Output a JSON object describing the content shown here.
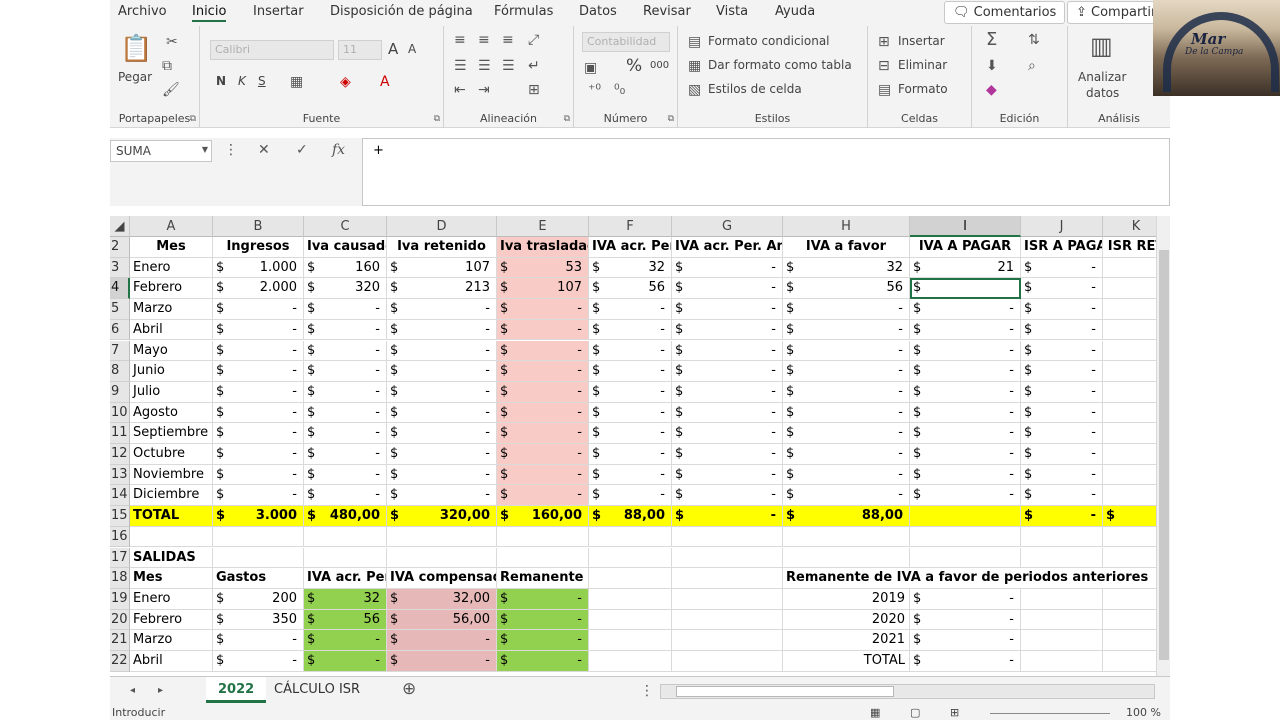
{
  "ribbon_tabs": [
    "Archivo",
    "Inicio",
    "Insertar",
    "Disposición de página",
    "Fórmulas",
    "Datos",
    "Revisar",
    "Vista",
    "Ayuda"
  ],
  "buttons": {
    "comentarios": "Comentarios",
    "compartir": "Compartir"
  },
  "groups": {
    "portapapeles": "Portapapeles",
    "fuente": "Fuente",
    "alineacion": "Alineación",
    "numero": "Número",
    "estilos": "Estilos",
    "celdas": "Celdas",
    "edicion": "Edición",
    "analisis": "Análisis"
  },
  "clip": {
    "pegar": "Pegar"
  },
  "font": {
    "name": "Calibri",
    "size": "11",
    "bold": "N",
    "italic": "K",
    "underline": "S",
    "grow": "A",
    "shrink": "A"
  },
  "numfmt": {
    "format": "Contabilidad",
    "percent": "%",
    "thousands": "000"
  },
  "styles": {
    "cond": "Formato condicional",
    "table": "Dar formato como tabla",
    "cell": "Estilos de celda"
  },
  "cells": {
    "insert": "Insertar",
    "delete": "Eliminar",
    "format": "Formato"
  },
  "analyze": {
    "l1": "Analizar",
    "l2": "datos"
  },
  "formula_bar": {
    "name_box": "SUMA",
    "formula": "+",
    "cancel": "✕",
    "enter": "✓",
    "fx": "fx"
  },
  "columns": [
    "A",
    "B",
    "C",
    "D",
    "E",
    "F",
    "G",
    "H",
    "I",
    "J",
    "K"
  ],
  "rows": [
    {
      "n": "2",
      "style": "header",
      "cells": [
        "Mes",
        "Ingresos",
        "Iva causado",
        "Iva retenido",
        "Iva trasladado",
        "IVA acr. Per.",
        "IVA acr. Per. Ant",
        "IVA a favor",
        "IVA A PAGAR",
        "ISR A PAGAR",
        "ISR RET"
      ]
    },
    {
      "n": "3",
      "cells": [
        "Enero",
        "1.000",
        "160",
        "107",
        "53",
        "32",
        "-",
        "32",
        "21",
        "-",
        ""
      ]
    },
    {
      "n": "4",
      "cells": [
        "Febrero",
        "2.000",
        "320",
        "213",
        "107",
        "56",
        "-",
        "56",
        "",
        "-",
        ""
      ]
    },
    {
      "n": "5",
      "cells": [
        "Marzo",
        "-",
        "-",
        "-",
        "-",
        "-",
        "-",
        "-",
        "-",
        "-",
        ""
      ]
    },
    {
      "n": "6",
      "cells": [
        "Abril",
        "-",
        "-",
        "-",
        "-",
        "-",
        "-",
        "-",
        "-",
        "-",
        ""
      ]
    },
    {
      "n": "7",
      "cells": [
        "Mayo",
        "-",
        "-",
        "-",
        "-",
        "-",
        "-",
        "-",
        "-",
        "-",
        ""
      ]
    },
    {
      "n": "8",
      "cells": [
        "Junio",
        "-",
        "-",
        "-",
        "-",
        "-",
        "-",
        "-",
        "-",
        "-",
        ""
      ]
    },
    {
      "n": "9",
      "cells": [
        "Julio",
        "-",
        "-",
        "-",
        "-",
        "-",
        "-",
        "-",
        "-",
        "-",
        ""
      ]
    },
    {
      "n": "10",
      "cells": [
        "Agosto",
        "-",
        "-",
        "-",
        "-",
        "-",
        "-",
        "-",
        "-",
        "-",
        ""
      ]
    },
    {
      "n": "11",
      "cells": [
        "Septiembre",
        "-",
        "-",
        "-",
        "-",
        "-",
        "-",
        "-",
        "-",
        "-",
        ""
      ]
    },
    {
      "n": "12",
      "cells": [
        "Octubre",
        "-",
        "-",
        "-",
        "-",
        "-",
        "-",
        "-",
        "-",
        "-",
        ""
      ]
    },
    {
      "n": "13",
      "cells": [
        "Noviembre",
        "-",
        "-",
        "-",
        "-",
        "-",
        "-",
        "-",
        "-",
        "-",
        ""
      ]
    },
    {
      "n": "14",
      "cells": [
        "Diciembre",
        "-",
        "-",
        "-",
        "-",
        "-",
        "-",
        "-",
        "-",
        "-",
        ""
      ]
    },
    {
      "n": "15",
      "style": "total",
      "cells": [
        "TOTAL",
        "3.000",
        "480,00",
        "320,00",
        "160,00",
        "88,00",
        "-",
        "88,00",
        "",
        "-",
        ""
      ]
    },
    {
      "n": "16",
      "cells": [
        "",
        "",
        "",
        "",
        "",
        "",
        "",
        "",
        "",
        "",
        ""
      ]
    },
    {
      "n": "17",
      "cells": [
        "SALIDAS",
        "",
        "",
        "",
        "",
        "",
        "",
        "",
        "",
        "",
        ""
      ]
    },
    {
      "n": "18",
      "style": "header2",
      "cells": [
        "Mes",
        "Gastos",
        "IVA acr. Per.",
        "IVA compensado",
        "Remanente de IVA",
        "",
        "",
        "Remanente de IVA a favor de periodos anteriores",
        "",
        "",
        ""
      ]
    },
    {
      "n": "19",
      "cells": [
        "Enero",
        "200",
        "32",
        "32,00",
        "-",
        "",
        "",
        "2019",
        "-",
        "",
        ""
      ]
    },
    {
      "n": "20",
      "cells": [
        "Febrero",
        "350",
        "56",
        "56,00",
        "-",
        "",
        "",
        "2020",
        "-",
        "",
        ""
      ]
    },
    {
      "n": "21",
      "cells": [
        "Marzo",
        "-",
        "-",
        "-",
        "-",
        "",
        "",
        "2021",
        "-",
        "",
        ""
      ]
    },
    {
      "n": "22",
      "cells": [
        "Abril",
        "-",
        "-",
        "-",
        "-",
        "",
        "",
        "TOTAL",
        "-",
        "",
        ""
      ]
    }
  ],
  "currency_symbol": "$",
  "selected_cell": {
    "col": "I",
    "row": "4"
  },
  "sheet_tabs": [
    "2022",
    "CÁLCULO ISR"
  ],
  "active_sheet": "2022",
  "status": {
    "mode": "Introducir",
    "zoom": "100 %"
  },
  "logo": {
    "line1": "Mar",
    "line2": "De la Campa"
  },
  "colors": {
    "yellow": "#ffff00",
    "pink": "#f8cbc6",
    "green": "#92d050",
    "pink2": "#e6b8b7",
    "accent": "#217346"
  }
}
